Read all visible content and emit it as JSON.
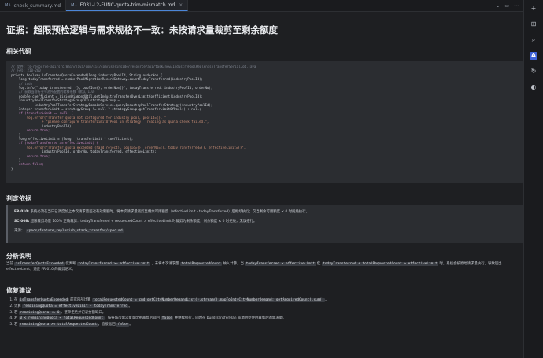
{
  "tabs": [
    {
      "label": "check_summary.md",
      "active": false
    },
    {
      "label": "E031-L2-FUNC-quota-trim-mismatch.md",
      "active": true
    }
  ],
  "tabbar_icons": [
    "chevron-down-icon",
    "split-editor-icon",
    "more-icon"
  ],
  "sidebar_icons": [
    "add-icon",
    "grid-icon",
    "search-icon",
    "a-icon",
    "refresh-icon",
    "bulb-icon"
  ],
  "title": "证据：超限预检逻辑与需求规格不一致：未按请求量裁剪至剩余额度",
  "sections": {
    "code": "相关代码",
    "judgement": "判定依据",
    "analysis": "分析说明",
    "fix": "修复建议"
  },
  "code_lines": [
    "// 文件: ts-resource-api/src/main/java/com/sis/com/userinside/resource/api/task/new/IndustryPoolReplenishTransferSerialJob.java",
    "// 行号: 210-260",
    "private boolean isTransferQuotaExceeded(long industryPoolId, String orderNo) {",
    "    long todayTransferred = numberPoolMigrationRecordGateway.countTodayTransferred(industryPoolId);",
    "    // todo",
    "    log.info(\"today transferred: {}, poolId={}, orderNo={}\", todayTransferred, industryPoolId, orderNo);",
    "    // 获取当前行业号池所配置的转移系数（默认 1.0）",
    "    double coefficient = VisionDiamondUtil.getIndustryTransferOverLimitCoefficient(industryPoolId);",
    "    IndustryPoolTransferStrategyGroupDTO strategyGroup =",
    "            industryPoolTransferStrategyDomainService.queryIndustryPoolTransferStrategy(industryPoolId);",
    "    Integer transferLimit = strategyGroup != null ? strategyGroup.getTransferLimitOfPool() : null;",
    "    if (transferLimit == null) {",
    "        log.error(\"Transfer quota not configured for industry pool, poolId={}, \"",
    "                + \"please configure transferLimitOfPool in strategy. Treating as quota check failed.\",",
    "                industryPoolId);",
    "        return true;",
    "    }",
    "    long effectiveLimit = (long) (transferLimit * coefficient);",
    "    if (todayTransferred >= effectiveLimit) {",
    "        log.error(\"Transfer quota exceeded (hard reject), poolId={}, orderNo={}, todayTransferred={}, effectiveLimit={}\",",
    "                industryPoolId, orderNo, todayTransferred, effectiveLimit);",
    "        return true;",
    "    }",
    "    return false;",
    "}"
  ],
  "judgement": {
    "line1_label": "FR-010:",
    "line1_text": "系统必须在当日已调度加上本次请求量超过有效限额时，将本次请求量裁剪至剩余可用额度（effectiveLimit - todayTransferred）后继续执行；仅当剩余可用额度 ≤ 0 时拒绝执行。",
    "line2_label": "SC-008:",
    "line2_text": "超限裁剪场景 100% 正确裁剪：todayTransferred + requestedCount > effectiveLimit 时裁剪为剩余额度，剩余额度 ≤ 0 时拒绝，无误拒行。",
    "source_label": "来源：",
    "source_path": "specs/feature_replenish_stack_transfer/spec.md"
  },
  "analysis": {
    "p1": "当前",
    "c1": "isTransferQuotaExceeded",
    "p2": "仅判断",
    "c2": "todayTransferred >= effectiveLimit",
    "p3": "，未将本次请求量",
    "c3": "totalRequestedCount",
    "p4": "纳入计算。当",
    "c4": "todayTransferred < effectiveLimit",
    "p5": "但",
    "c5": "todayTransferred + totalRequestedCount > effectiveLimit",
    "p6": "时，系统会按原始请求量执行，导致超出 effectiveLimit，违反 FR-010 的裁剪语义。"
  },
  "fix": [
    {
      "pre": "在",
      "c1": "isTransferQuotaExceeded",
      "mid": "前或内部计算",
      "c2": "totalRequestedCount = cmd.getCityNumberDemandList().stream().mapToInt(CityNumberDemand::getRequiredCount).sum()",
      "post": "。"
    },
    {
      "pre": "计算",
      "c1": "remainingQuota = effectiveLimit - todayTransferred",
      "mid": "。",
      "c2": "",
      "post": ""
    },
    {
      "pre": "若",
      "c1": "remainingQuota <= 0",
      "mid": "，整单拒绝并记录金额缺口。",
      "c2": "",
      "post": ""
    },
    {
      "pre": "若",
      "c1": "0 < remainingQuota < totalRequestedCount",
      "mid": "，按各城市需求量等比例裁剪后返回",
      "c2": "false",
      "post": "并继续执行，同时在 buildTransferPlan 或调用处使用裁剪后的需求量。"
    },
    {
      "pre": "若",
      "c1": "remainingQuota >= totalRequestedCount",
      "mid": "，直接返回",
      "c2": "false",
      "post": "。"
    }
  ]
}
